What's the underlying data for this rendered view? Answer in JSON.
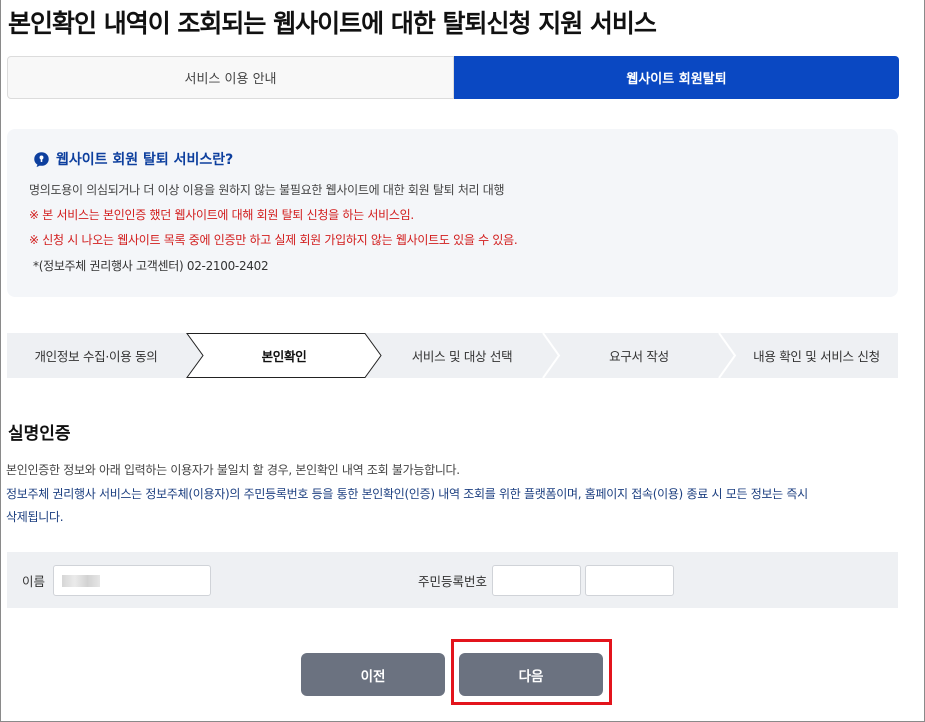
{
  "page": {
    "title": "본인확인 내역이 조회되는 웹사이트에 대한 탈퇴신청 지원 서비스"
  },
  "tabs": [
    {
      "label": "서비스 이용 안내",
      "active": false
    },
    {
      "label": "웹사이트 회원탈퇴",
      "active": true
    }
  ],
  "info": {
    "icon": "question-bubble-icon",
    "title": "웹사이트 회원 탈퇴 서비스란?",
    "line1": "명의도용이 의심되거나 더 이상 이용을 원하지 않는 불필요한 웹사이트에 대한 회원 탈퇴 처리 대행",
    "line2": "※ 본 서비스는 본인인증 했던 웹사이트에 대해 회원 탈퇴 신청을 하는 서비스임.",
    "line3": "※ 신청 시 나오는 웹사이트 목록 중에 인증만 하고 실제 회원 가입하지 않는 웹사이트도 있을 수 있음.",
    "line4": "*(정보주체 권리행사 고객센터) 02-2100-2402"
  },
  "steps": [
    {
      "label": "개인정보 수집·이용 동의",
      "current": false
    },
    {
      "label": "본인확인",
      "current": true
    },
    {
      "label": "서비스 및 대상 선택",
      "current": false
    },
    {
      "label": "요구서 작성",
      "current": false
    },
    {
      "label": "내용 확인 및 서비스 신청",
      "current": false
    }
  ],
  "section": {
    "title": "실명인증",
    "desc1": "본인인증한 정보와 아래 입력하는 이용자가 불일치 할 경우, 본인확인 내역 조회 불가능합니다.",
    "desc2": "정보주체 권리행사 서비스는 정보주체(이용자)의 주민등록번호 등을 통한 본인확인(인증) 내역 조회를 위한 플랫폼이며, 홈페이지 접속(이용) 종료 시 모든 정보는 즉시",
    "desc3": "삭제됩니다."
  },
  "form": {
    "name_label": "이름",
    "rrn_label": "주민등록번호",
    "rrn_front_value": "",
    "rrn_back_value": ""
  },
  "buttons": {
    "prev": "이전",
    "next": "다음"
  },
  "colors": {
    "primary": "#0a48c2",
    "warning": "#d21d1d",
    "button": "#6b7280",
    "highlight": "#e3141c"
  }
}
